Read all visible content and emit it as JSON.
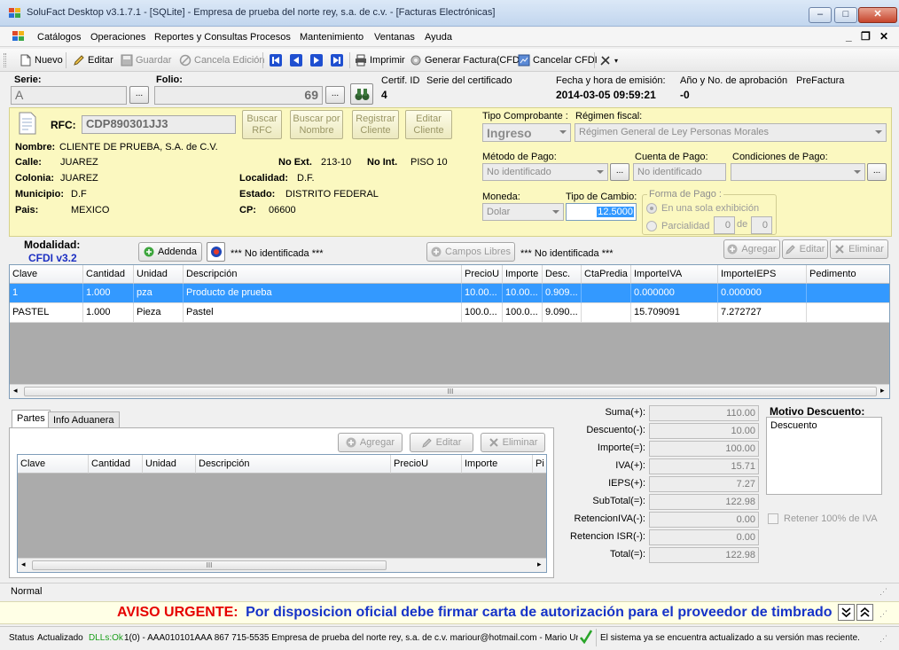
{
  "window": {
    "title": "SoluFact Desktop v3.1.7.1 - [SQLite] - Empresa de prueba del norte rey, s.a. de c.v. - [Facturas Electrónicas]",
    "minimize": "–",
    "maximize": "□",
    "close": "✕"
  },
  "menu": {
    "items": [
      "Catálogos",
      "Operaciones",
      "Reportes y Consultas",
      "Procesos",
      "Mantenimiento",
      "Ventanas",
      "Ayuda"
    ],
    "right_controls": [
      "_",
      "❐",
      "✕"
    ]
  },
  "toolbar": {
    "nuevo": "Nuevo",
    "editar": "Editar",
    "guardar": "Guardar",
    "cancela": "Cancela Edición",
    "imprimir": "Imprimir",
    "generar": "Generar Factura(CFDI)",
    "cancelar_cfdi": "Cancelar CFDI"
  },
  "header": {
    "serie_label": "Serie:",
    "serie_value": "A",
    "folio_label": "Folio:",
    "folio_value": "69",
    "certif_label": "Certif. ID",
    "certif_value": "4",
    "serie_cert_label": "Serie del certificado",
    "fecha_label": "Fecha y hora de emisión:",
    "fecha_value": "2014-03-05 09:59:21",
    "anio_label": "Año y No. de aprobación",
    "anio_value": "-0",
    "prefactura": "PreFactura",
    "dots": "..."
  },
  "client": {
    "rfc_label": "RFC:",
    "rfc_value": "CDP890301JJ3",
    "buscar_rfc": [
      "Buscar",
      "RFC"
    ],
    "buscar_nombre": [
      "Buscar por",
      "Nombre"
    ],
    "registrar": [
      "Registrar",
      "Cliente"
    ],
    "editar": [
      "Editar",
      "Cliente"
    ],
    "nombre_label": "Nombre:",
    "nombre_value": "CLIENTE DE PRUEBA, S.A. de C.V.",
    "calle_label": "Calle:",
    "calle_value": "JUAREZ",
    "noext_label": "No Ext.",
    "noext_value": "213-10",
    "noint_label": "No Int.",
    "noint_value": "PISO 10",
    "colonia_label": "Colonia:",
    "colonia_value": "JUAREZ",
    "localidad_label": "Localidad:",
    "localidad_value": "D.F.",
    "municipio_label": "Municipio:",
    "municipio_value": "D.F",
    "estado_label": "Estado:",
    "estado_value": "DISTRITO FEDERAL",
    "pais_label": "Pais:",
    "pais_value": "MEXICO",
    "cp_label": "CP:",
    "cp_value": "06600"
  },
  "comprobante": {
    "tipo_label": "Tipo Comprobante :",
    "tipo_value": "Ingreso",
    "regimen_label": "Régimen fiscal:",
    "regimen_value": "Régimen General de Ley Personas Morales",
    "metodo_label": "Método de Pago:",
    "metodo_value": "No identificado",
    "cuenta_label": "Cuenta de Pago:",
    "cuenta_value": "No identificado",
    "condiciones_label": "Condiciones de Pago:",
    "condiciones_value": "",
    "moneda_label": "Moneda:",
    "moneda_value": "Dolar",
    "cambio_label": "Tipo de Cambio:",
    "cambio_value": "12.5000",
    "forma_label": "Forma de Pago :",
    "forma_opt1": "En una sola exhibición",
    "forma_opt2": "Parcialidad",
    "parc_value": "0",
    "parc_de": "de",
    "parc_total": "0"
  },
  "modalidad": {
    "label": "Modalidad:",
    "value": "CFDI v3.2",
    "addenda": "Addenda",
    "addenda_value": "*** No identificada ***",
    "campos": "Campos Libres",
    "campos_value": "*** No identificada ***",
    "agregar": "Agregar",
    "editar": "Editar",
    "eliminar": "Eliminar"
  },
  "grid": {
    "columns": [
      "Clave",
      "Cantidad",
      "Unidad",
      "Descripción",
      "PrecioU",
      "Importe",
      "Desc.",
      "CtaPredia",
      "ImporteIVA",
      "ImporteIEPS",
      "Pedimento"
    ],
    "rows": [
      [
        "1",
        "1.000",
        "pza",
        "Producto de prueba",
        "10.00...",
        "10.00...",
        "0.909...",
        "",
        "0.000000",
        "0.000000",
        ""
      ],
      [
        "PASTEL",
        "1.000",
        "Pieza",
        "Pastel",
        "100.0...",
        "100.0...",
        "9.090...",
        "",
        "15.709091",
        "7.272727",
        ""
      ]
    ],
    "scroll_grip": "III"
  },
  "parts": {
    "tabs": [
      "Partes",
      "Info Aduanera"
    ],
    "agregar": "Agregar",
    "editar": "Editar",
    "eliminar": "Eliminar",
    "columns": [
      "Clave",
      "Cantidad",
      "Unidad",
      "Descripción",
      "PrecioU",
      "Importe",
      "Pi"
    ],
    "scroll_grip": "III"
  },
  "totals": {
    "labels": [
      "Suma(+):",
      "Descuento(-):",
      "Importe(=):",
      "IVA(+):",
      "IEPS(+):",
      "SubTotal(=):",
      "RetencionIVA(-):",
      "Retencion ISR(-):",
      "Total(=):"
    ],
    "values": [
      "110.00",
      "10.00",
      "100.00",
      "15.71",
      "7.27",
      "122.98",
      "0.00",
      "0.00",
      "122.98"
    ],
    "motivo_label": "Motivo Descuento:",
    "motivo_value": "Descuento",
    "retener": "Retener 100% de IVA"
  },
  "status": {
    "mode": "Normal",
    "aviso_label": "AVISO URGENTE:",
    "aviso_text": "Por disposicion oficial debe firmar carta de autorización para el proveedor de timbrado",
    "bar_status": "Status",
    "bar_actualizado": "Actualizado",
    "bar_dlls": "DLLs:Ok",
    "bar_info": "1(0) - AAA010101AAA  867 715-5535  Empresa de prueba del norte rey, s.a. de c.v.  mariour@hotmail.com - Mario Uriar",
    "bar_msg": "El sistema ya se encuentra actualizado a su versión mas reciente."
  },
  "colors": {
    "selection": "#3399ff",
    "panel_yellow": "#fbf8c0",
    "aviso_red": "#e60000",
    "aviso_blue": "#1633c8",
    "link_blue": "#1c2fc2"
  }
}
